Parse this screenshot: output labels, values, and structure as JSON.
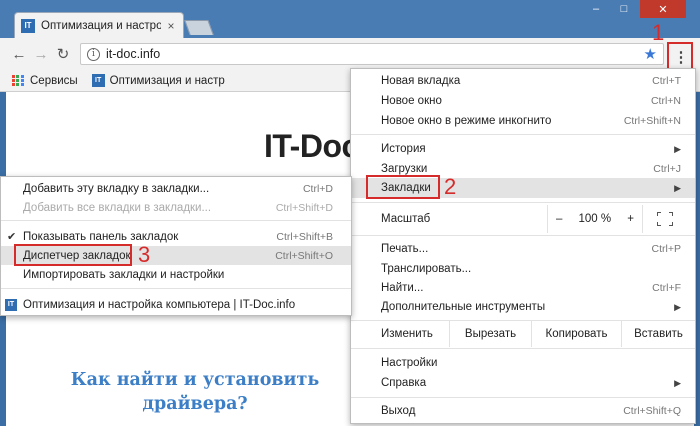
{
  "browser": {
    "tab_title": "Оптимизация и настройк",
    "tab_favicon": "IT",
    "url": "it-doc.info",
    "bookmarks_bar": [
      {
        "label": "Сервисы",
        "icon": "apps-icon"
      },
      {
        "label": "Оптимизация и настр",
        "icon": "IT"
      }
    ]
  },
  "page": {
    "site_title": "IT-Doc",
    "headline_line1": "Как найти и установить",
    "headline_line2": "драйвера?"
  },
  "main_menu": {
    "items": [
      {
        "label": "Новая вкладка",
        "shortcut": "Ctrl+T"
      },
      {
        "label": "Новое окно",
        "shortcut": "Ctrl+N"
      },
      {
        "label": "Новое окно в режиме инкогнито",
        "shortcut": "Ctrl+Shift+N"
      },
      {
        "label": "История",
        "shortcut": ""
      },
      {
        "label": "Загрузки",
        "shortcut": "Ctrl+J"
      },
      {
        "label": "Закладки",
        "shortcut": ""
      }
    ],
    "zoom": {
      "label": "Масштаб",
      "minus": "–",
      "value": "100 %",
      "plus": "+"
    },
    "items2": [
      {
        "label": "Печать...",
        "shortcut": "Ctrl+P"
      },
      {
        "label": "Транслировать...",
        "shortcut": ""
      },
      {
        "label": "Найти...",
        "shortcut": "Ctrl+F"
      },
      {
        "label": "Дополнительные инструменты",
        "shortcut": ""
      }
    ],
    "edit": {
      "label": "Изменить",
      "cut": "Вырезать",
      "copy": "Копировать",
      "paste": "Вставить"
    },
    "items3": [
      {
        "label": "Настройки",
        "shortcut": ""
      },
      {
        "label": "Справка",
        "shortcut": ""
      },
      {
        "label": "Выход",
        "shortcut": "Ctrl+Shift+Q"
      }
    ]
  },
  "bookmarks_submenu": {
    "items": [
      {
        "label": "Добавить эту вкладку в закладки...",
        "shortcut": "Ctrl+D"
      },
      {
        "label": "Добавить все вкладки в закладки...",
        "shortcut": "Ctrl+Shift+D"
      },
      {
        "label": "Показывать панель закладок",
        "shortcut": "Ctrl+Shift+B"
      },
      {
        "label": "Диспетчер закладок",
        "shortcut": "Ctrl+Shift+O"
      },
      {
        "label": "Импортировать закладки и настройки",
        "shortcut": ""
      },
      {
        "label": "Оптимизация и настройка компьютера | IT-Doc.info",
        "shortcut": ""
      }
    ]
  },
  "annotations": {
    "step1": "1",
    "step2": "2",
    "step3": "3"
  },
  "colors": {
    "annotation": "#d62b2b",
    "accent": "#3a78d8",
    "headline": "#3d7fc6"
  }
}
